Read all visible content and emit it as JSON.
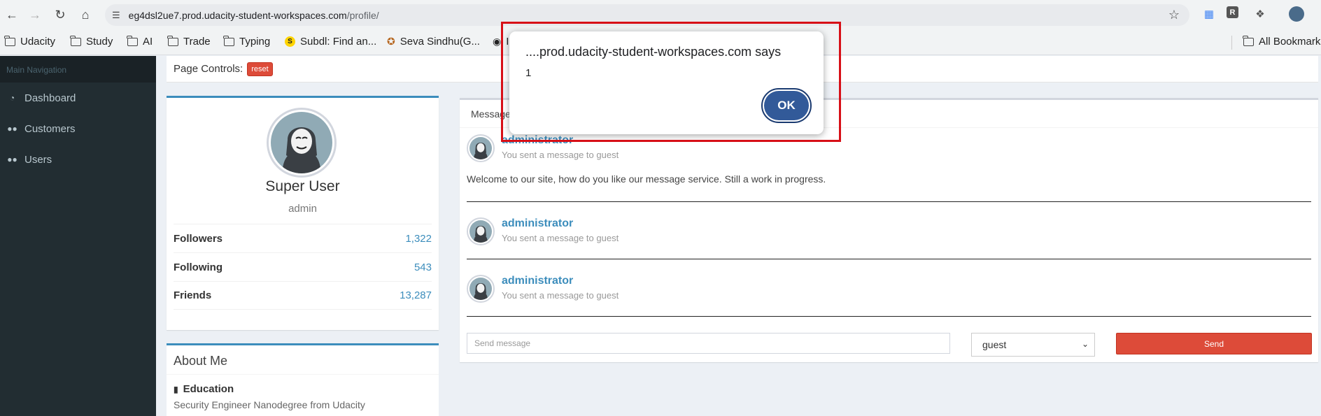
{
  "browser": {
    "url_host": "eg4dsl2ue7.prod.udacity-student-workspaces.com",
    "url_path": "/profile/",
    "bookmarks": [
      {
        "label": "Udacity",
        "icon": "folder-icon"
      },
      {
        "label": "Study",
        "icon": "folder-icon"
      },
      {
        "label": "AI",
        "icon": "folder-icon"
      },
      {
        "label": "Trade",
        "icon": "folder-icon"
      },
      {
        "label": "Typing",
        "icon": "folder-icon"
      },
      {
        "label": "Subdl: Find an...",
        "icon": "subdl-icon"
      },
      {
        "label": "Seva Sindhu(G...",
        "icon": "emblem-icon"
      },
      {
        "label": "I",
        "icon": "github-icon"
      }
    ],
    "all_bookmarks": "All Bookmarks"
  },
  "sidebar": {
    "header": "Main Navigation",
    "items": [
      {
        "label": "Dashboard",
        "icon": "dashboard-icon"
      },
      {
        "label": "Customers",
        "icon": "users-icon"
      },
      {
        "label": "Users",
        "icon": "users-icon"
      }
    ]
  },
  "page_controls": {
    "label": "Page Controls:",
    "reset": "reset"
  },
  "profile": {
    "name": "Super User",
    "role": "admin",
    "stats": [
      {
        "label": "Followers",
        "value": "1,322"
      },
      {
        "label": "Following",
        "value": "543"
      },
      {
        "label": "Friends",
        "value": "13,287"
      }
    ]
  },
  "about": {
    "title": "About Me",
    "education_heading": "Education",
    "education_text": "Security Engineer Nanodegree from Udacity"
  },
  "messages": {
    "title": "Message",
    "items": [
      {
        "user": "administrator",
        "desc": "You sent a message to guest",
        "text": "Welcome to our site, how do you like our message service. Still a work in progress."
      },
      {
        "user": "administrator",
        "desc": "You sent a message to guest",
        "text": ""
      },
      {
        "user": "administrator",
        "desc": "You sent a message to guest",
        "text": ""
      }
    ],
    "input_placeholder": "Send message",
    "recipient": "guest",
    "send_label": "Send"
  },
  "alert": {
    "title": "....prod.udacity-student-workspaces.com says",
    "body": "1",
    "ok": "OK"
  },
  "colors": {
    "highlight": "#d70f17",
    "accent": "#3c8dbc",
    "danger": "#dd4b39"
  }
}
